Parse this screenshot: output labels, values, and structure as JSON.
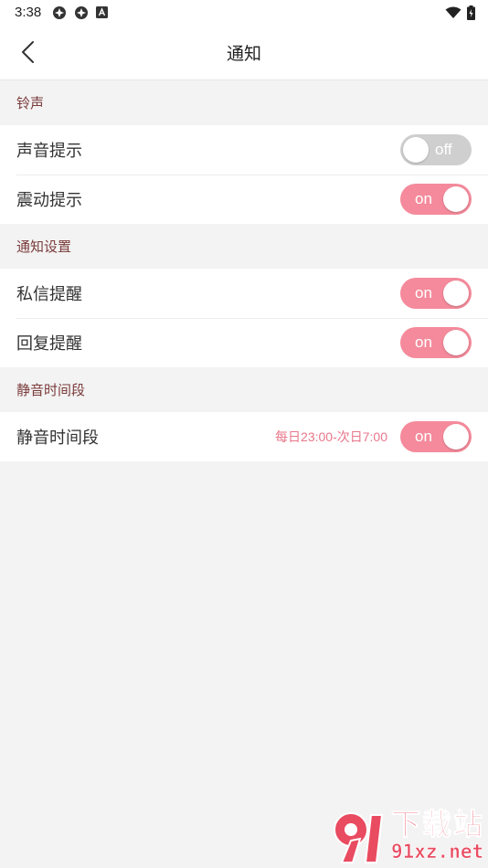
{
  "status_bar": {
    "time": "3:38",
    "icons": [
      "settings-gear-icon",
      "settings-gear-icon",
      "a-badge-icon"
    ],
    "right_icons": [
      "wifi-icon",
      "battery-icon"
    ]
  },
  "header": {
    "title": "通知"
  },
  "sections": [
    {
      "title": "铃声",
      "rows": [
        {
          "label": "声音提示",
          "toggle_state": "off",
          "toggle_text": "off"
        },
        {
          "label": "震动提示",
          "toggle_state": "on",
          "toggle_text": "on"
        }
      ]
    },
    {
      "title": "通知设置",
      "rows": [
        {
          "label": "私信提醒",
          "toggle_state": "on",
          "toggle_text": "on"
        },
        {
          "label": "回复提醒",
          "toggle_state": "on",
          "toggle_text": "on"
        }
      ]
    },
    {
      "title": "静音时间段",
      "rows": [
        {
          "label": "静音时间段",
          "value": "每日23:00-次日7:00",
          "toggle_state": "on",
          "toggle_text": "on"
        }
      ]
    }
  ],
  "colors": {
    "accent": "#f48a9b",
    "toggle_off": "#cfcfcf",
    "section_title": "#7b3b3b",
    "value_text": "#e8768a"
  },
  "watermark": {
    "cn": "下载站",
    "en": "91xz.net",
    "logo_text": "91"
  }
}
